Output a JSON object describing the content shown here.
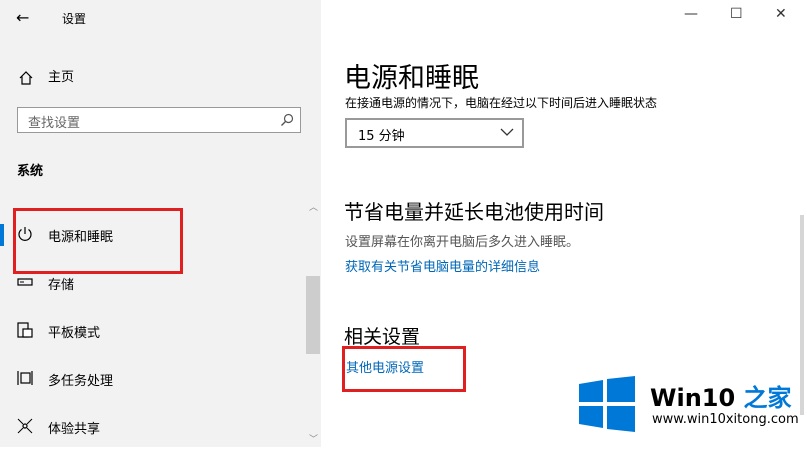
{
  "window": {
    "title": "设置",
    "back_glyph": "←",
    "minimize_glyph": "—",
    "maximize_glyph": "☐",
    "close_glyph": "✕"
  },
  "sidebar": {
    "home_label": "主页",
    "search_placeholder": "查找设置",
    "section_label": "系统",
    "items": [
      {
        "label": "电源和睡眠",
        "icon": "power-icon",
        "selected": true
      },
      {
        "label": "存储",
        "icon": "storage-icon"
      },
      {
        "label": "平板模式",
        "icon": "tablet-mode-icon"
      },
      {
        "label": "多任务处理",
        "icon": "multitasking-icon"
      },
      {
        "label": "体验共享",
        "icon": "shared-experiences-icon"
      }
    ]
  },
  "main": {
    "title": "电源和睡眠",
    "sleep_desc": "在接通电源的情况下，电脑在经过以下时间后进入睡眠状态",
    "sleep_value": "15 分钟",
    "save_title": "节省电量并延长电池使用时间",
    "save_desc": "设置屏幕在你离开电脑后多久进入睡眠。",
    "save_link": "获取有关节省电脑电量的详细信息",
    "related_title": "相关设置",
    "related_link": "其他电源设置"
  },
  "watermark": {
    "brand_prefix": "Win10",
    "brand_suffix": "之家",
    "url": "www.win10xitong.com"
  },
  "colors": {
    "accent": "#0078d7",
    "link": "#0067b8",
    "highlight_box": "#e02020",
    "sidebar_bg": "#f2f2f2"
  }
}
